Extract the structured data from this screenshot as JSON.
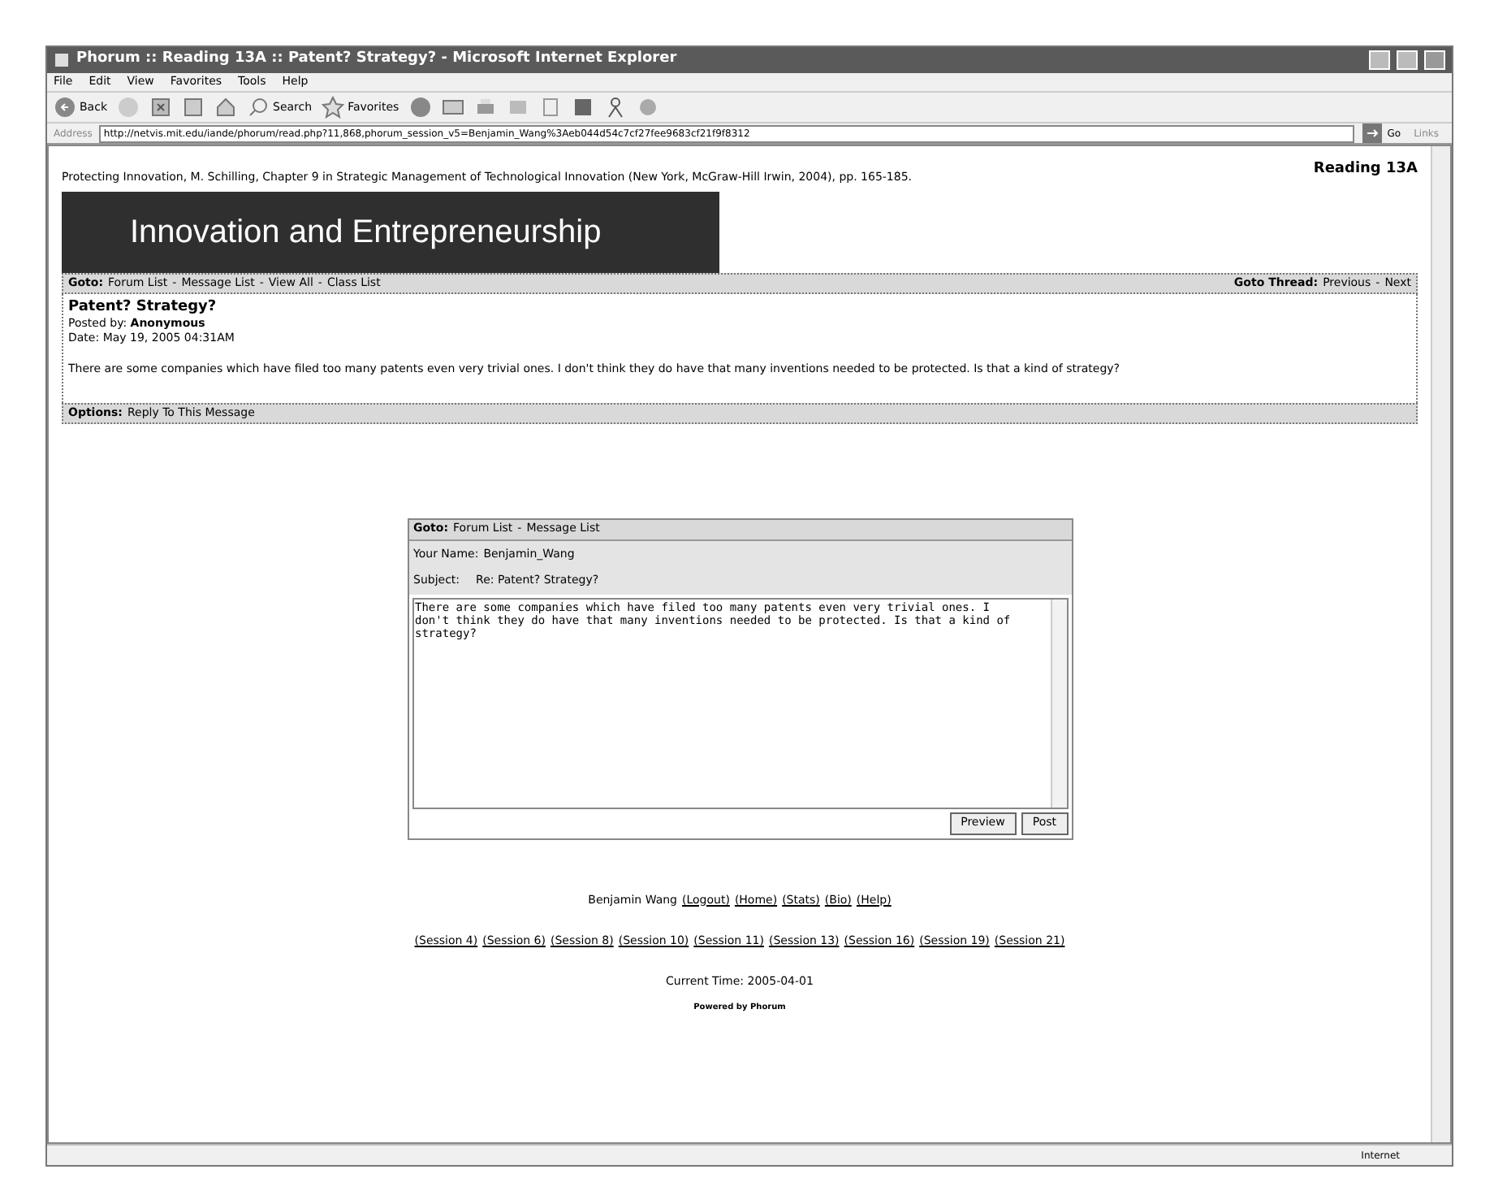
{
  "window": {
    "title": "Phorum :: Reading 13A :: Patent? Strategy? - Microsoft Internet Explorer"
  },
  "menu": [
    "File",
    "Edit",
    "View",
    "Favorites",
    "Tools",
    "Help"
  ],
  "toolbar": {
    "back": "Back",
    "search": "Search",
    "favorites": "Favorites"
  },
  "address_bar": {
    "label": "Address",
    "url": "http://netvis.mit.edu/iande/phorum/read.php?11,868,phorum_session_v5=Benjamin_Wang%3Aeb044d54c7cf27fee9683cf21f9f8312",
    "go": "Go",
    "links": "Links"
  },
  "page": {
    "citation": "Protecting Innovation, M. Schilling, Chapter 9 in Strategic Management of Technological Innovation (New York, McGraw-Hill Irwin, 2004), pp. 165-185.",
    "reading": "Reading 13A",
    "banner": "Innovation and Entrepreneurship",
    "goto": {
      "label": "Goto:",
      "separator": "-",
      "links": [
        "Forum List",
        "Message List",
        "View All",
        "Class List"
      ]
    },
    "goto_thread": {
      "label": "Goto Thread:",
      "separator": "-",
      "links": [
        "Previous",
        "Next"
      ]
    },
    "post": {
      "title": "Patent? Strategy?",
      "posted_by_label": "Posted by:",
      "author": "Anonymous",
      "date": "Date: May 19, 2005 04:31AM",
      "body": "There are some companies which have filed too many patents even very trivial ones. I don't think they do have that many inventions needed to be protected. Is that a kind of strategy?"
    },
    "options": {
      "label": "Options:",
      "links": [
        "Reply To This Message"
      ]
    },
    "reply_form": {
      "goto": {
        "label": "Goto:",
        "separator": "-",
        "links": [
          "Forum List",
          "Message List"
        ]
      },
      "name_label": "Your Name:",
      "name": "Benjamin_Wang",
      "subject_label": "Subject:",
      "subject": "Re: Patent? Strategy?",
      "message": "There are some companies which have filed too many patents even very trivial ones. I don't think they do have that many inventions needed to be protected. Is that a kind of strategy?",
      "buttons": [
        "Preview",
        "Post"
      ]
    },
    "user_line": {
      "name": "Benjamin Wang",
      "links": [
        "(Logout)",
        "(Home)",
        "(Stats)",
        "(Bio)",
        "(Help)"
      ]
    },
    "sessions": [
      "(Session 4)",
      "(Session 6)",
      "(Session 8)",
      "(Session 10)",
      "(Session 11)",
      "(Session 13)",
      "(Session 16)",
      "(Session 19)",
      "(Session 21)"
    ],
    "current_time": "Current Time: 2005-04-01",
    "powered_by": "Powered by Phorum"
  },
  "status_bar": {
    "zone": "Internet"
  }
}
